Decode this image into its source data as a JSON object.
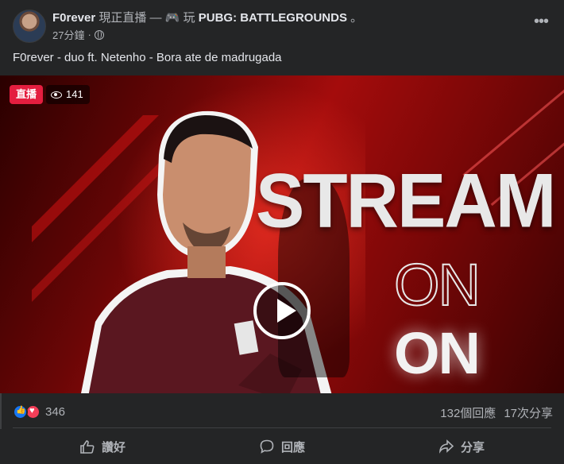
{
  "post": {
    "author": "F0rever",
    "activity_prefix": "現正直播 — ",
    "game_emoji": "🎮",
    "activity_verb": " 玩 ",
    "game_name": "PUBG: BATTLEGROUNDS",
    "activity_suffix": " 。",
    "time": "27分鐘",
    "separator": "·",
    "privacy_icon": "globe-icon",
    "more_icon": "more-horizontal-icon",
    "text": "F0rever - duo ft. Netenho - Bora ate de madrugada"
  },
  "video": {
    "live_label": "直播",
    "viewer_count": "141",
    "thumbnail_headline": "STREAM",
    "thumbnail_word_1": "ON",
    "thumbnail_word_2": "ON",
    "thumbnail_word_3": "ON",
    "play_icon": "play-icon"
  },
  "stats": {
    "reaction_count": "346",
    "comments": "132個回應",
    "shares": "17次分享"
  },
  "actions": {
    "like_label": "讚好",
    "comment_label": "回應",
    "share_label": "分享"
  },
  "colors": {
    "background": "#242526",
    "live_red": "#e41e3f",
    "like_blue": "#1877f2",
    "love_red": "#f33e58",
    "text_primary": "#e4e6eb",
    "text_secondary": "#b0b3b8"
  }
}
